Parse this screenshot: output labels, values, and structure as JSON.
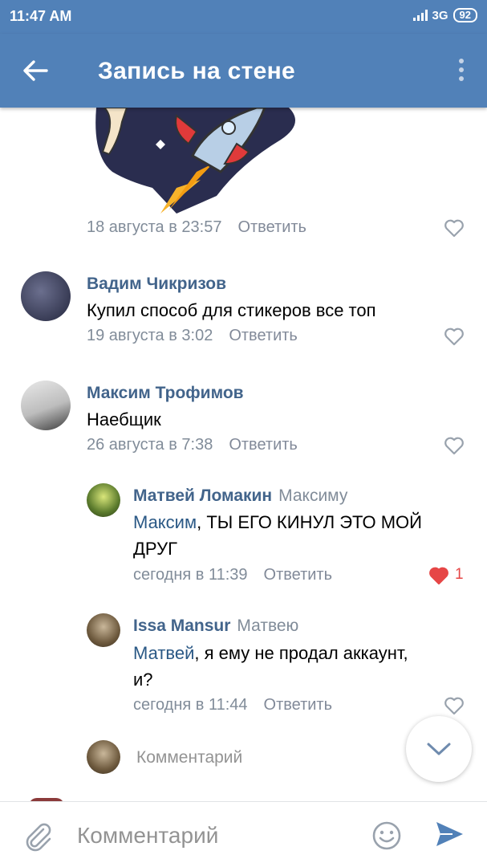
{
  "status": {
    "time": "11:47 AM",
    "network": "3G",
    "battery": "92"
  },
  "appbar": {
    "title": "Запись на стене"
  },
  "sticker_comment": {
    "date": "18 августа в 23:57",
    "reply": "Ответить"
  },
  "comments": [
    {
      "name": "Вадим Чикризов",
      "text": "Купил способ для стикеров все топ",
      "date": "19 августа в 3:02",
      "reply": "Ответить"
    },
    {
      "name": "Максим Трофимов",
      "text": "Наебщик",
      "date": "26 августа в 7:38",
      "reply": "Ответить"
    }
  ],
  "replies": [
    {
      "name": "Матвей Ломакин",
      "to": "Максиму",
      "mention": "Максим",
      "text_line1": ", ТЫ ЕГО КИНУЛ ЭТО МОЙ",
      "text_line2": "ДРУГ",
      "date": "сегодня в 11:39",
      "reply": "Ответить",
      "likes": "1",
      "liked": true
    },
    {
      "name": "Issa Mansur",
      "to": "Матвею",
      "mention": "Матвей",
      "text_line1": ", я ему не продал аккаунт,",
      "text_line2": "и?",
      "date": "сегодня в 11:44",
      "reply": "Ответить",
      "liked": false
    }
  ],
  "inline_comment": {
    "placeholder": "Комментарий"
  },
  "bottombar": {
    "placeholder": "Комментарий"
  },
  "colors": {
    "header": "#5181b8",
    "name": "#42648b",
    "meta": "#818c99",
    "like_active": "#e64646",
    "send": "#5181b8"
  },
  "icons": [
    "back-arrow-icon",
    "more-vertical-icon",
    "heart-icon",
    "chevron-down-icon",
    "paperclip-icon",
    "smile-icon",
    "send-icon"
  ]
}
